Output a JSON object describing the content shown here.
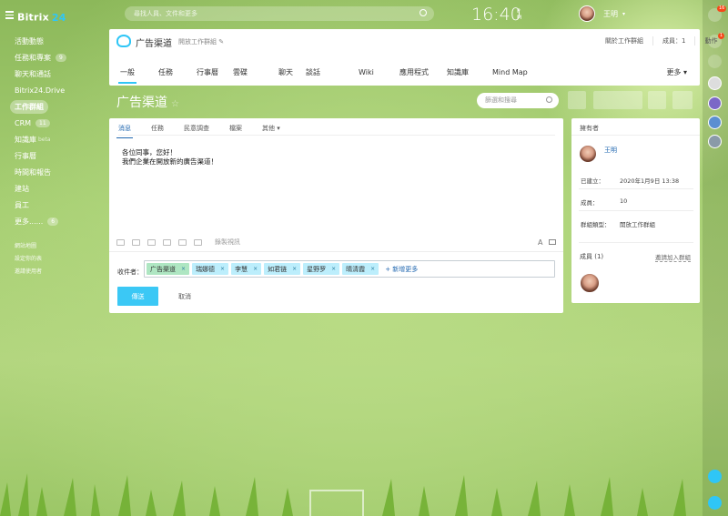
{
  "app": {
    "name": "Bitrix",
    "version": "24"
  },
  "sidebar": {
    "items": [
      {
        "label": "活動動態",
        "count": ""
      },
      {
        "label": "任務和專案",
        "count": "9"
      },
      {
        "label": "聊天和通話",
        "count": ""
      },
      {
        "label": "Bitrix24.Drive",
        "count": ""
      },
      {
        "label": "工作群組",
        "count": "",
        "active": true
      },
      {
        "label": "CRM",
        "count": "11"
      },
      {
        "label": "知識庫",
        "count": "",
        "beta": "beta"
      },
      {
        "label": "行事曆",
        "count": ""
      },
      {
        "label": "時間和報告",
        "count": ""
      },
      {
        "label": "建站",
        "count": ""
      },
      {
        "label": "員工",
        "count": ""
      },
      {
        "label": "更多......",
        "count": "6"
      }
    ],
    "small_links": [
      "網站地圖",
      "設定你的表",
      "邀請使用者"
    ]
  },
  "topbar": {
    "search_placeholder": "尋找人員、文件和更多",
    "time": "16:40",
    "ampm_top": "P",
    "ampm_bottom": "M",
    "user_name": "王明",
    "user_chevron": "▾"
  },
  "rail": {
    "badge_top": "16",
    "badge_second": "1"
  },
  "group": {
    "name": "广告渠道",
    "type": "開放工作群組",
    "about": "關於工作群組",
    "members": "成員：1",
    "actions": "動作"
  },
  "tabs": [
    "一般",
    "任務",
    "行事曆",
    "雲碟",
    "聊天",
    "談話",
    "Wiki",
    "應用程式",
    "知識庫",
    "Mind Map"
  ],
  "tabs_more": "更多 ▾",
  "page": {
    "title": "广告渠道",
    "filter_placeholder": "篩選和搜尋"
  },
  "post": {
    "tabs": [
      "消息",
      "任務",
      "民意調查",
      "檔案",
      "其他 ▾"
    ],
    "message_line1": "各位同事，您好！",
    "message_line2": "我們企業在開放新的廣告渠道！",
    "record_video": "錄製視訊",
    "recipients_label": "收件者：",
    "recipients": [
      "广告渠道",
      "瑞娜德",
      "李慧",
      "如君链",
      "星野罗",
      "晴清霞"
    ],
    "add_more": "+ 新增更多",
    "send": "傳送",
    "cancel": "取消",
    "font_icon": "A"
  },
  "owner_card": {
    "title": "擁有者",
    "name": "王明",
    "created_label": "已建立：",
    "created_value": "2020年1月9日 13:38",
    "members_label": "成員：",
    "members_value": "10",
    "type_label": "群組類型：",
    "type_value": "開放工作群組",
    "members_section": "成員 (1)",
    "invite": "邀請加入群組"
  },
  "colors": {
    "accent": "#2fc6f6",
    "link": "#2067b0",
    "send": "#3bc8f5",
    "chip": "#bceefc",
    "badge": "#f54819"
  }
}
